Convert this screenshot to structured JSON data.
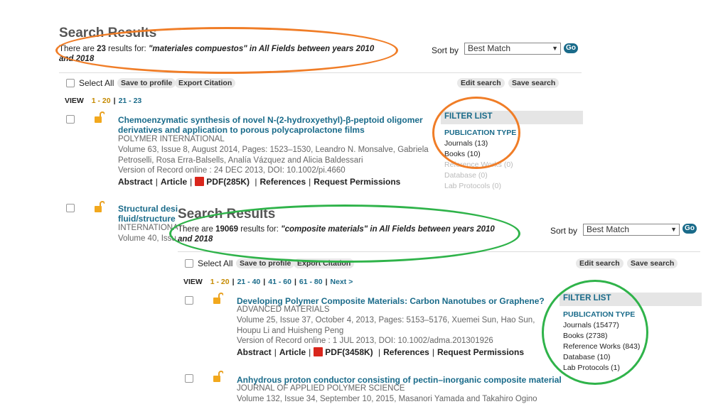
{
  "back": {
    "title": "Search Results",
    "count_prefix": "There are ",
    "count": "23",
    "count_mid": " results for: ",
    "query": "\"materiales compuestos\" in All Fields between years 2010",
    "query_line2": "and 2018",
    "sort_label": "Sort by",
    "sort_value": "Best Match",
    "go_label": "Go",
    "select_all": "Select All",
    "save_to_profile": "Save to profile",
    "export_citation": "Export Citation",
    "edit_search": "Edit search",
    "save_search": "Save search",
    "view_label": "VIEW",
    "pages": [
      "1 - 20",
      "21 - 23"
    ],
    "filter": {
      "header": "FILTER LIST",
      "type_label": "PUBLICATION TYPE",
      "items": [
        "Journals (13)",
        "Books (10)",
        "Reference Works (0)",
        "Database (0)",
        "Lab Protocols (0)"
      ]
    },
    "articles": [
      {
        "title_line1": "Chemoenzymatic synthesis of novel N-(2-hydroxyethyl)-β-peptoid oligomer",
        "title_line2": "derivatives and application to porous polycaprolactone films",
        "journal": "POLYMER INTERNATIONAL",
        "meta1": "Volume 63, Issue 8, August 2014, Pages: 1523–1530, Leandro N. Monsalve, Gabriela",
        "meta2": "Petroselli, Rosa Erra-Balsells, Analía Vázquez and Alicia Baldessari",
        "meta3": "Version of Record online : 24 DEC 2013, DOI: 10.1002/pi.4660",
        "abstract": "Abstract",
        "article": "Article",
        "pdf": "PDF(285K)",
        "references": "References",
        "permissions": "Request Permissions"
      },
      {
        "title_line1": "Structural desi",
        "title_line2": "fluid/structure",
        "journal": "INTERNATIONAL",
        "meta1": "Volume 40, Issu"
      }
    ]
  },
  "front": {
    "title": "Search Results",
    "count_prefix": "There are ",
    "count": "19069",
    "count_mid": " results for: ",
    "query": "\"composite materials\" in All Fields between years 2010",
    "query_line2": "and 2018",
    "sort_label": "Sort by",
    "sort_value": "Best Match",
    "go_label": "Go",
    "select_all": "Select All",
    "save_to_profile": "Save to profile",
    "export_citation": "Export Citation",
    "edit_search": "Edit search",
    "save_search": "Save search",
    "view_label": "VIEW",
    "pages": [
      "1 - 20",
      "21 - 40",
      "41 - 60",
      "61 - 80",
      "Next >"
    ],
    "filter": {
      "header": "FILTER LIST",
      "type_label": "PUBLICATION TYPE",
      "items": [
        "Journals (15477)",
        "Books (2738)",
        "Reference Works (843)",
        "Database (10)",
        "Lab Protocols (1)"
      ]
    },
    "articles": [
      {
        "title_line1": "Developing Polymer Composite Materials: Carbon Nanotubes or Graphene?",
        "journal": "ADVANCED MATERIALS",
        "meta1": "Volume 25, Issue 37, October 4, 2013, Pages: 5153–5176, Xuemei Sun, Hao Sun,",
        "meta2": "Houpu Li and Huisheng Peng",
        "meta3": "Version of Record online : 1 JUL 2013, DOI: 10.1002/adma.201301926",
        "abstract": "Abstract",
        "article": "Article",
        "pdf": "PDF(3458K)",
        "references": "References",
        "permissions": "Request Permissions"
      },
      {
        "title_line1": "Anhydrous proton conductor consisting of pectin–inorganic composite material",
        "journal": "JOURNAL OF APPLIED POLYMER SCIENCE",
        "meta1": "Volume 132, Issue 34, September 10, 2015, Masanori Yamada and Takahiro Ogino"
      }
    ]
  },
  "colors": {
    "link": "#1a6b8a",
    "current_page": "#c58a00",
    "orange_annotation": "#f07d27",
    "green_annotation": "#2fb34a",
    "pdf_icon": "#d9261c"
  }
}
